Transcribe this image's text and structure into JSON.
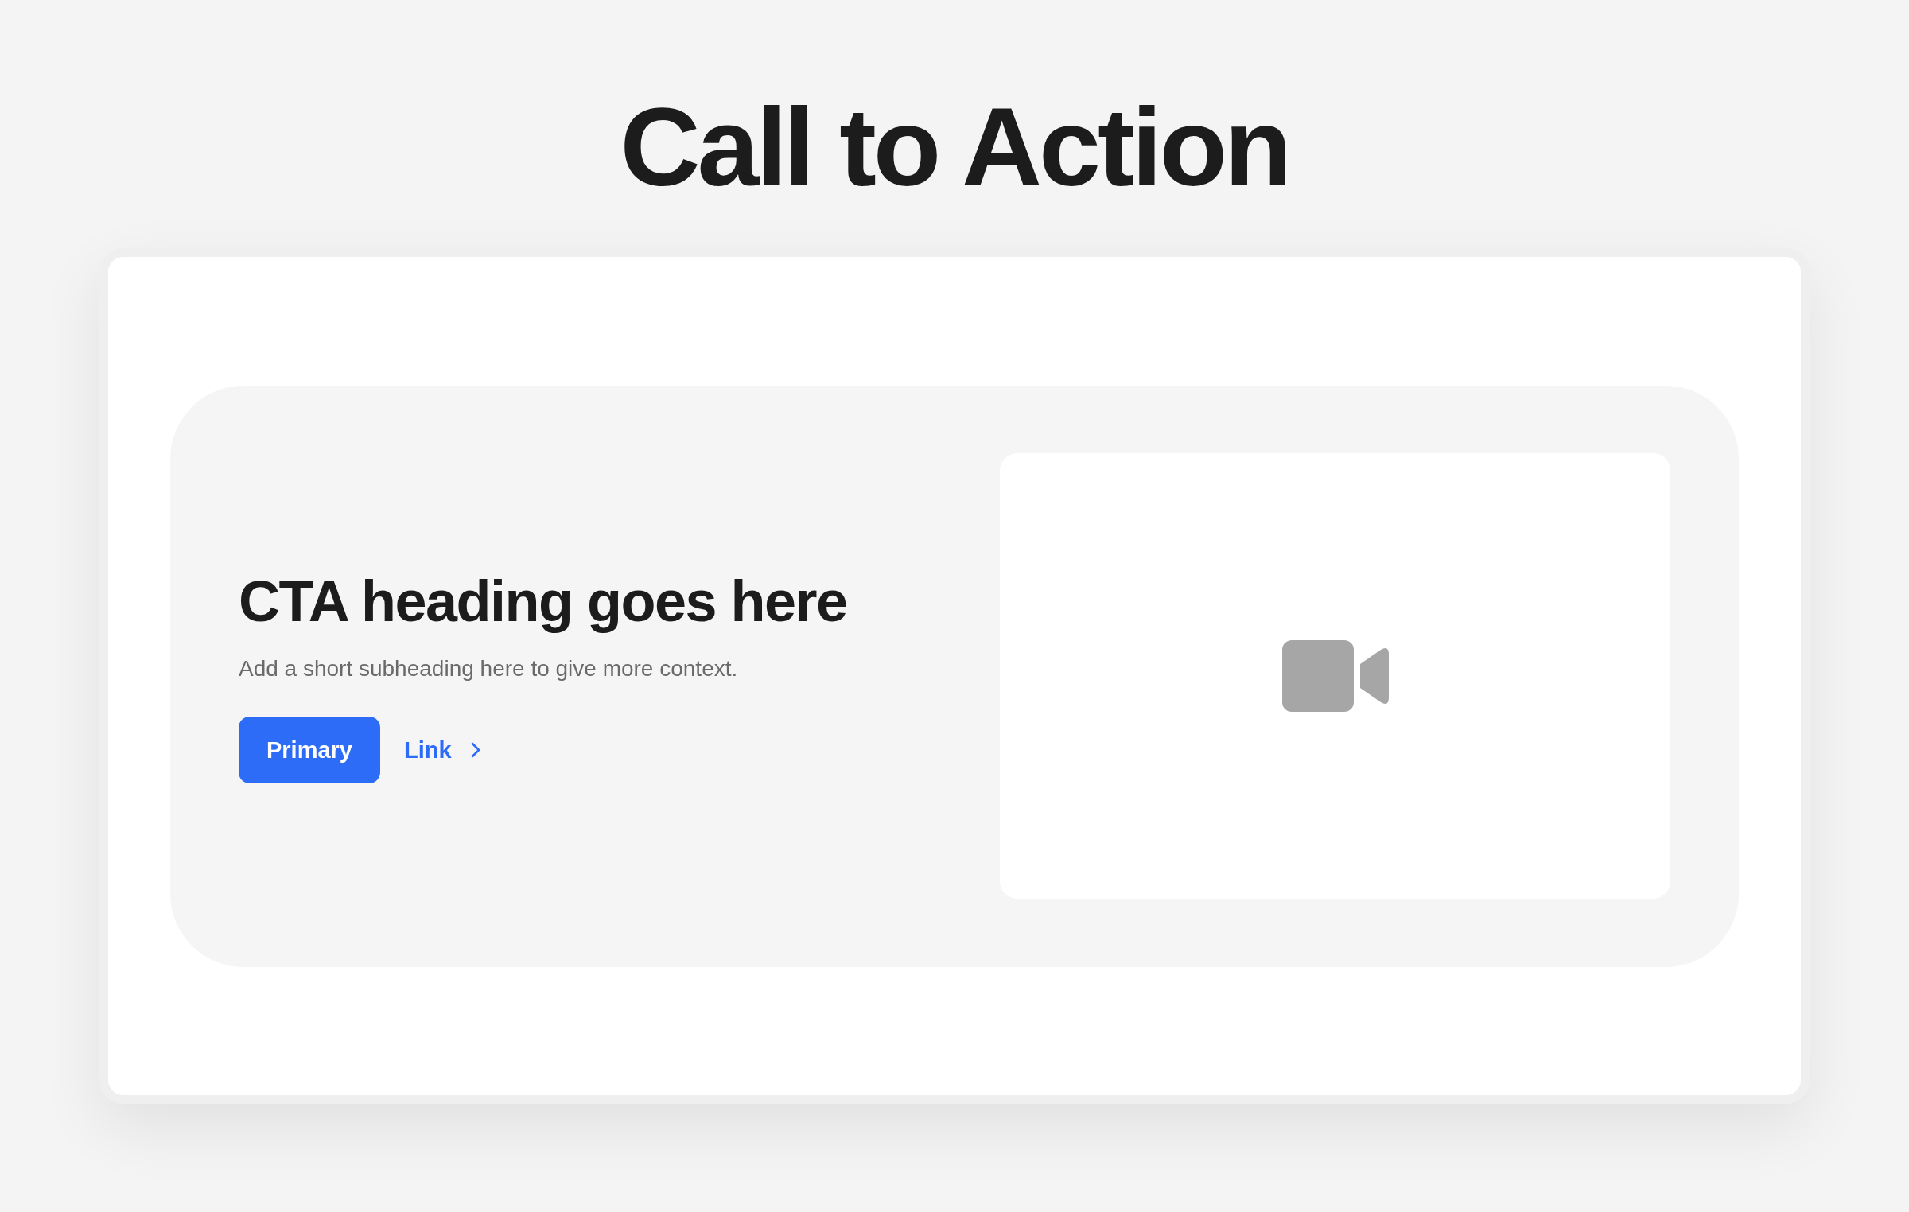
{
  "page_title": "Call to Action",
  "cta": {
    "heading": "CTA heading goes here",
    "subheading": "Add a short subheading here to give more context.",
    "primary_button": "Primary",
    "link": "Link"
  }
}
